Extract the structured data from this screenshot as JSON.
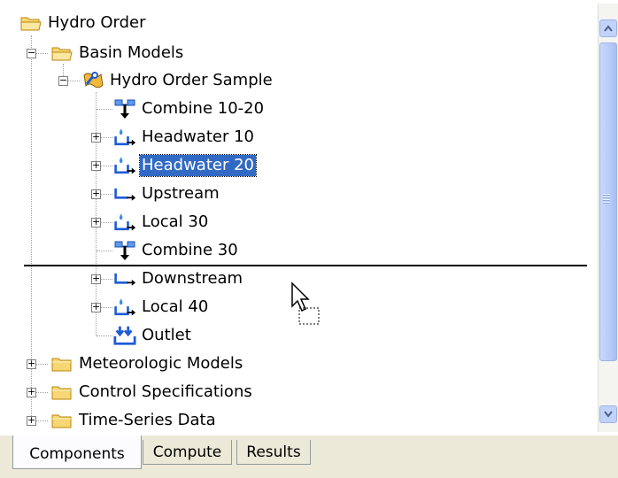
{
  "tree": {
    "root_label": "Hydro Order",
    "basin_models_label": "Basin Models",
    "basin_label": "Hydro Order Sample",
    "elements": [
      {
        "label": "Combine 10-20",
        "icon": "junction-icon"
      },
      {
        "label": "Headwater 10",
        "icon": "subbasin-icon"
      },
      {
        "label": "Headwater 20",
        "icon": "subbasin-icon",
        "selected": true
      },
      {
        "label": "Upstream",
        "icon": "reach-icon"
      },
      {
        "label": "Local 30",
        "icon": "subbasin-icon"
      },
      {
        "label": "Combine 30",
        "icon": "junction-icon"
      },
      {
        "label": "Downstream",
        "icon": "reach-icon"
      },
      {
        "label": "Local 40",
        "icon": "subbasin-icon"
      },
      {
        "label": "Outlet",
        "icon": "sink-icon"
      }
    ],
    "folders": [
      {
        "label": "Meteorologic Models"
      },
      {
        "label": "Control Specifications"
      },
      {
        "label": "Time-Series Data"
      }
    ]
  },
  "tabs": {
    "components": "Components",
    "compute": "Compute",
    "results": "Results"
  },
  "colors": {
    "selection": "#316ac5",
    "folder": "#f7d774",
    "element_blue": "#1f5bd6",
    "scrollbar": "#c1d3fb"
  }
}
